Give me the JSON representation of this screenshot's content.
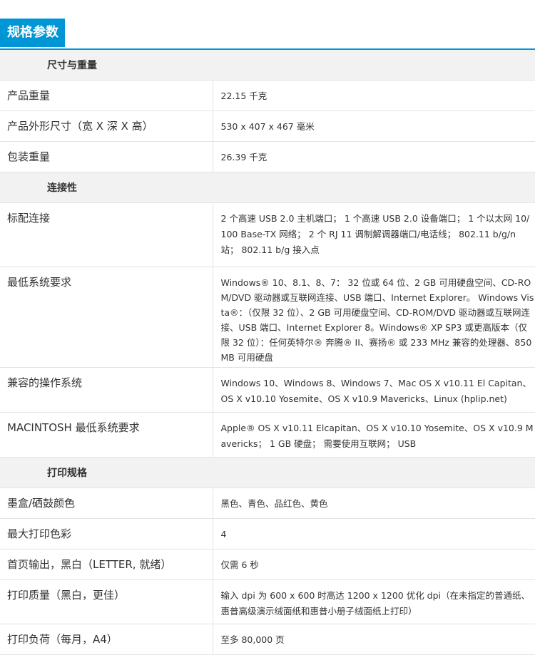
{
  "header": {
    "tab_label": "规格参数"
  },
  "sections": [
    {
      "title": "尺寸与重量",
      "rows": [
        {
          "label": "产品重量",
          "value": "22.15 千克"
        },
        {
          "label": "产品外形尺寸（宽 X 深 X 高）",
          "value": "530 x 407 x 467 毫米"
        },
        {
          "label": "包装重量",
          "value": "26.39 千克"
        }
      ]
    },
    {
      "title": "连接性",
      "rows": [
        {
          "label": "标配连接",
          "value": "2 个高速 USB 2.0 主机端口； 1 个高速 USB 2.0 设备端口； 1 个以太网 10/100 Base-TX 网络； 2 个 RJ 11 调制解调器端口/电话线； 802.11 b/g/n 站； 802.11 b/g 接入点"
        },
        {
          "label": "最低系统要求",
          "value": "Windows® 10、8.1、8、7： 32 位或 64 位、2 GB 可用硬盘空间、CD-ROM/DVD 驱动器或互联网连接、USB 端口、Internet Explorer。 Windows Vista®：（仅限 32 位）、2 GB 可用硬盘空间、CD-ROM/DVD 驱动器或互联网连接、USB 端口、Internet Explorer 8。Windows® XP SP3 或更高版本（仅限 32 位）：任何英特尔® 奔腾® II、赛扬® 或 233 MHz 兼容的处理器、850 MB 可用硬盘"
        },
        {
          "label": "兼容的操作系统",
          "value": "Windows 10、Windows 8、Windows 7、Mac OS X v10.11 El Capitan、OS X v10.10 Yosemite、OS X v10.9 Mavericks、Linux (hplip.net)"
        },
        {
          "label": "MACINTOSH 最低系统要求",
          "value": "Apple® OS X v10.11 Elcapitan、OS X v10.10 Yosemite、OS X v10.9 Mavericks； 1 GB 硬盘； 需要使用互联网； USB"
        }
      ]
    },
    {
      "title": "打印规格",
      "rows": [
        {
          "label": "墨盒/硒鼓颜色",
          "value": "黑色、青色、品红色、黄色"
        },
        {
          "label": "最大打印色彩",
          "value": "4"
        },
        {
          "label": "首页输出，黑白（LETTER, 就绪）",
          "value": "仅需 6 秒"
        },
        {
          "label": "打印质量（黑白，更佳）",
          "value": "输入 dpi 为 600 x 600 时高达 1200 x 1200 优化 dpi（在未指定的普通纸、惠普高级演示绒面纸和惠普小册子绒面纸上打印）"
        },
        {
          "label": "打印负荷（每月，A4）",
          "value": "至多 80,000 页"
        }
      ]
    }
  ]
}
